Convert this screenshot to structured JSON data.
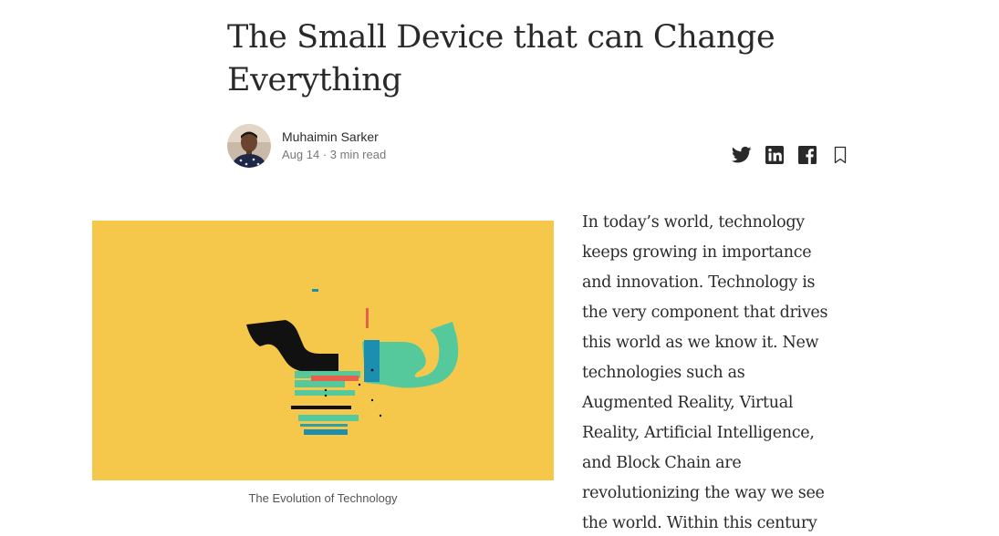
{
  "article": {
    "title": "The Small Device that can Change Everything",
    "author": {
      "name": "Muhaimin Sarker",
      "date": "Aug 14",
      "read_time": "3 min read",
      "meta": "Aug 14 · 3 min read"
    },
    "share": {
      "icons": [
        "twitter-icon",
        "linkedin-icon",
        "facebook-icon",
        "bookmark-icon"
      ]
    },
    "figure": {
      "caption": "The Evolution of Technology",
      "background_color": "#F5C84C"
    },
    "body_lines": [
      "In today’s world, technology",
      "keeps growing in importance",
      "and innovation. Technology is",
      "the very component that drives",
      "this world as we know it. New",
      "technologies such as",
      "Augmented Reality, Virtual",
      "Reality, Artificial Intelligence,",
      "and Block Chain are",
      "revolutionizing the way we see",
      "the world. Within this century"
    ]
  },
  "colors": {
    "text": "#292929",
    "meta": "#757575",
    "hero_yellow": "#F5C84C",
    "hero_green": "#55C99C",
    "hero_black": "#111111",
    "hero_red": "#E8604C",
    "hero_teal": "#1C8FB0"
  }
}
